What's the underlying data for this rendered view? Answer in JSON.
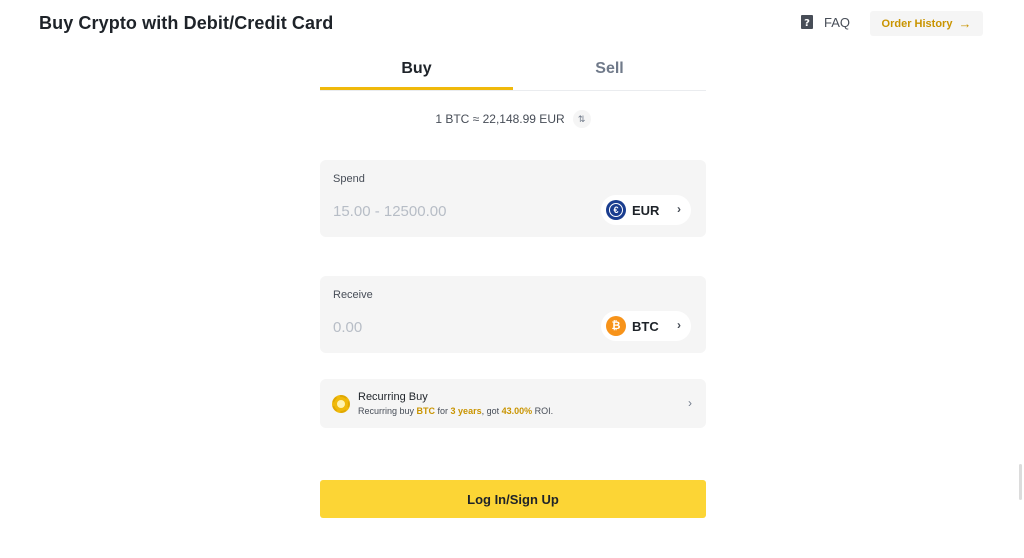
{
  "header": {
    "title": "Buy Crypto with Debit/Credit Card",
    "faq_label": "FAQ",
    "order_history_label": "Order History",
    "order_history_arrow": "→"
  },
  "tabs": [
    {
      "label": "Buy",
      "active": true
    },
    {
      "label": "Sell",
      "active": false
    }
  ],
  "rate": {
    "text": "1 BTC ≈ 22,148.99 EUR",
    "swap_glyph": "⇅"
  },
  "spend": {
    "label": "Spend",
    "placeholder": "15.00 - 12500.00",
    "currency": "EUR",
    "currency_icon": "euro-coin-icon"
  },
  "receive": {
    "label": "Receive",
    "placeholder": "0.00",
    "currency": "BTC",
    "currency_icon": "bitcoin-coin-icon"
  },
  "recurring": {
    "title": "Recurring Buy",
    "desc_prefix": "Recurring buy ",
    "desc_coin": "BTC",
    "desc_mid1": " for ",
    "desc_period": "3 years",
    "desc_mid2": ", got ",
    "desc_roi": "43.00%",
    "desc_suffix": " ROI."
  },
  "cta": {
    "label": "Log In/Sign Up"
  },
  "colors": {
    "accent": "#f0b90b",
    "button": "#fcd535",
    "highlight": "#c99400",
    "field_bg": "#f5f5f5"
  }
}
